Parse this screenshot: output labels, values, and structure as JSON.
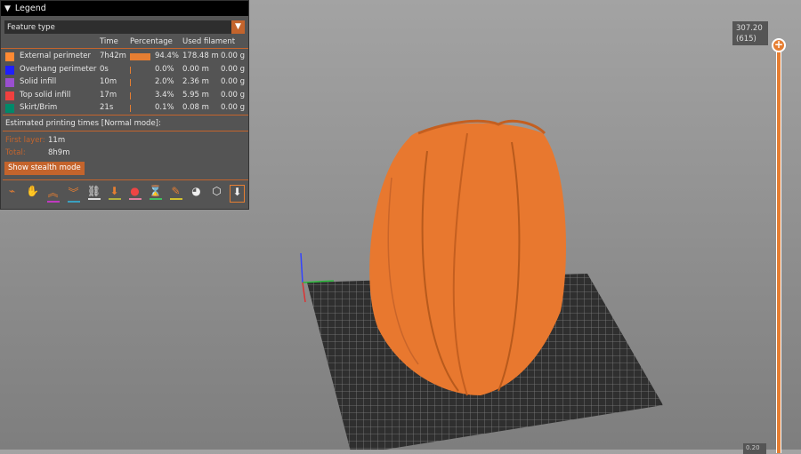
{
  "legend": {
    "title": "Legend",
    "view_type": "Feature type",
    "headers": {
      "time": "Time",
      "percentage": "Percentage",
      "filament": "Used filament"
    },
    "rows": [
      {
        "name": "External perimeter",
        "color": "#ff8a33",
        "time": "7h42m",
        "pct": "94.4%",
        "pct_value": 94.4,
        "length": "178.48 m",
        "weight": "0.00 g"
      },
      {
        "name": "Overhang perimeter",
        "color": "#1f1fff",
        "time": "0s",
        "pct": "0.0%",
        "pct_value": 0.0,
        "length": "0.00 m",
        "weight": "0.00 g"
      },
      {
        "name": "Solid infill",
        "color": "#9a4fd0",
        "time": "10m",
        "pct": "2.0%",
        "pct_value": 2.0,
        "length": "2.36 m",
        "weight": "0.00 g"
      },
      {
        "name": "Top solid infill",
        "color": "#f0403f",
        "time": "17m",
        "pct": "3.4%",
        "pct_value": 3.4,
        "length": "5.95 m",
        "weight": "0.00 g"
      },
      {
        "name": "Skirt/Brim",
        "color": "#008a6a",
        "time": "21s",
        "pct": "0.1%",
        "pct_value": 0.1,
        "length": "0.08 m",
        "weight": "0.00 g"
      }
    ],
    "estimated_label": "Estimated printing times [Normal mode]:",
    "first_layer_label": "First layer:",
    "first_layer": "11m",
    "total_label": "Total:",
    "total": "8h9m",
    "stealth_button": "Show stealth mode"
  },
  "slider": {
    "top_value": "307.20",
    "top_layer": "(615)",
    "bottom_value": "0.20"
  }
}
